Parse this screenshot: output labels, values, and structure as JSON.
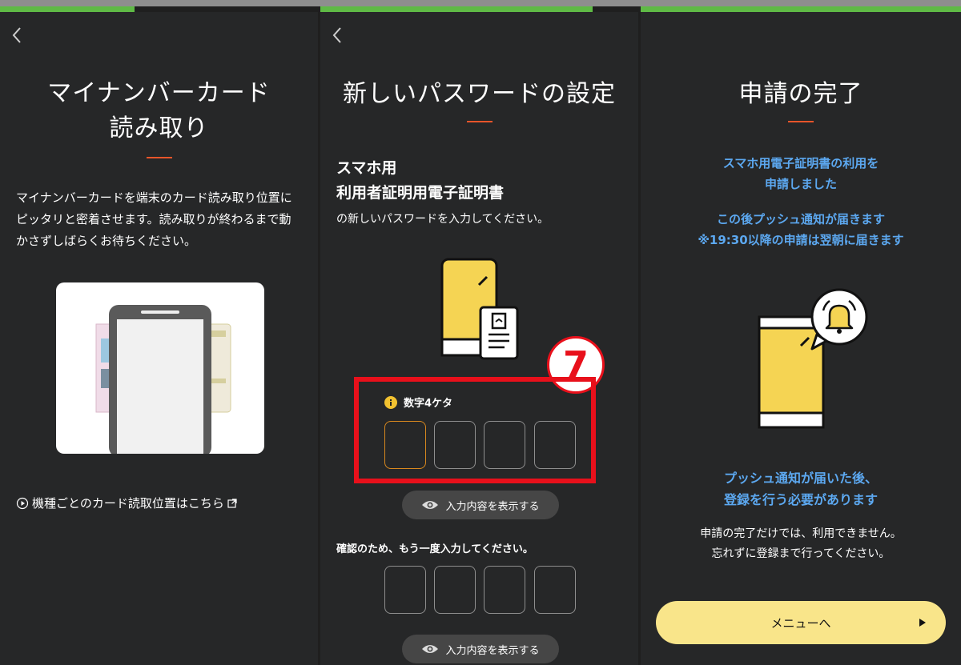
{
  "panel1": {
    "title_line1": "マイナンバーカード",
    "title_line2": "読み取り",
    "desc_line1": "マイナンバーカードを端末のカード読み取り位置に",
    "desc_line2": "ピッタリと密着させます。読み取りが終わるまで動",
    "desc_line3": "かさずしばらくお待ちください。",
    "link": "機種ごとのカード読取位置はこちら"
  },
  "panel2": {
    "title": "新しいパスワードの設定",
    "heading_line1": "スマホ用",
    "heading_line2": "利用者証明用電子証明書",
    "instruction": "の新しいパスワードを入力してください。",
    "step_number": "7",
    "pin_hint": "数字4ケタ",
    "show_button": "入力内容を表示する",
    "confirm_text": "確認のため、もう一度入力してください。",
    "show_button2": "入力内容を表示する"
  },
  "panel3": {
    "title": "申請の完了",
    "msg1_line1": "スマホ用電子証明書の利用を",
    "msg1_line2": "申請しました",
    "msg2_line1": "この後プッシュ通知が届きます",
    "msg2_line2": "※19:30以降の申請は翌朝に届きます",
    "msg3_line1": "プッシュ通知が届いた後、",
    "msg3_line2": "登録を行う必要があります",
    "note_line1": "申請の完了だけでは、利用できません。",
    "note_line2": "忘れずに登録まで行ってください。",
    "menu_button": "メニューへ"
  },
  "colors": {
    "accent_underline": "#e8552a",
    "progress_green": "#5fba46",
    "highlight_red": "#e8101b",
    "info_blue": "#5ca8f0",
    "button_yellow": "#f9e58a",
    "phone_yellow": "#f5d453"
  },
  "icons": [
    "back-chevron-icon",
    "play-circle-icon",
    "external-link-icon",
    "info-icon",
    "eye-icon",
    "bell-icon",
    "play-triangle-icon"
  ]
}
